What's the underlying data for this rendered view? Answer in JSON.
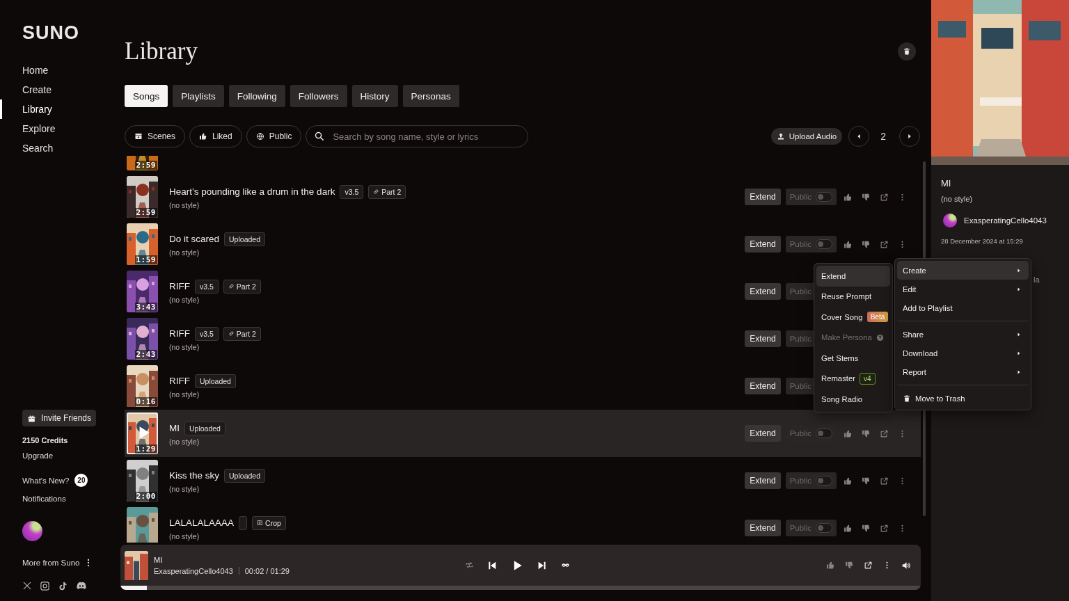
{
  "sidebar": {
    "logo": "SUNO",
    "nav": [
      {
        "label": "Home",
        "selected": false
      },
      {
        "label": "Create",
        "selected": false
      },
      {
        "label": "Library",
        "selected": true
      },
      {
        "label": "Explore",
        "selected": false
      },
      {
        "label": "Search",
        "selected": false
      }
    ],
    "invite_button": "Invite Friends",
    "credits": "2150 Credits",
    "upgrade": "Upgrade",
    "whats_new": {
      "label": "What's New?",
      "count": "20"
    },
    "notifications": "Notifications",
    "more_from": "More from Suno"
  },
  "page": {
    "title": "Library"
  },
  "tabs": [
    {
      "label": "Songs",
      "selected": true
    },
    {
      "label": "Playlists",
      "selected": false
    },
    {
      "label": "Following",
      "selected": false
    },
    {
      "label": "Followers",
      "selected": false
    },
    {
      "label": "History",
      "selected": false
    },
    {
      "label": "Personas",
      "selected": false
    }
  ],
  "filters": [
    {
      "label": "Scenes",
      "kind": "scenes"
    },
    {
      "label": "Liked",
      "kind": "liked"
    },
    {
      "label": "Public",
      "kind": "public"
    }
  ],
  "search": {
    "placeholder": "Search by song name, style or lyrics"
  },
  "upload_button": "Upload Audio",
  "pagination": {
    "page": "2"
  },
  "songs": [
    {
      "duration": "2:59",
      "selected": false
    },
    {
      "title": "Heart’s pounding like a drum in the dark",
      "badges": [
        {
          "kind": "version",
          "text": "v3.5"
        },
        {
          "kind": "part",
          "text": "Part 2"
        }
      ],
      "style": "(no style)",
      "duration": "2:59",
      "selected": false,
      "public": false,
      "extend_label": "Extend",
      "public_label": "Public"
    },
    {
      "title": "Do it scared",
      "badges": [
        {
          "kind": "uploaded",
          "text": "Uploaded"
        }
      ],
      "style": "(no style)",
      "duration": "1:59",
      "selected": false,
      "public": false,
      "extend_label": "Extend",
      "public_label": "Public"
    },
    {
      "title": "RIFF",
      "badges": [
        {
          "kind": "version",
          "text": "v3.5"
        },
        {
          "kind": "part",
          "text": "Part 2"
        }
      ],
      "style": "(no style)",
      "duration": "3:43",
      "selected": false,
      "extend_label": "Extend",
      "public_label": "Public"
    },
    {
      "title": "RIFF",
      "badges": [
        {
          "kind": "version",
          "text": "v3.5"
        },
        {
          "kind": "part",
          "text": "Part 2"
        }
      ],
      "style": "(no style)",
      "duration": "2:43",
      "selected": false,
      "extend_label": "Extend",
      "public_label": "Public"
    },
    {
      "title": "RIFF",
      "badges": [
        {
          "kind": "uploaded",
          "text": "Uploaded"
        }
      ],
      "style": "(no style)",
      "duration": "0:16",
      "selected": false,
      "extend_label": "Extend",
      "public_label": "Public"
    },
    {
      "title": "MI",
      "badges": [
        {
          "kind": "uploaded",
          "text": "Uploaded"
        }
      ],
      "style": "(no style)",
      "duration": "1:29",
      "selected": true,
      "public": false,
      "extend_label": "Extend",
      "public_label": "Public"
    },
    {
      "title": "Kiss the sky",
      "badges": [
        {
          "kind": "uploaded",
          "text": "Uploaded"
        }
      ],
      "style": "(no style)",
      "duration": "2:00",
      "selected": false,
      "public": false,
      "extend_label": "Extend",
      "public_label": "Public"
    },
    {
      "title": "LALALALAAAA",
      "badges": [
        {
          "kind": "blank"
        },
        {
          "kind": "crop",
          "text": "Crop"
        }
      ],
      "style": "(no style)",
      "selected": false,
      "public": false,
      "extend_label": "Extend",
      "public_label": "Public"
    }
  ],
  "context_menu": {
    "actions": [
      {
        "label": "Extend",
        "selected": true,
        "disabled": false
      },
      {
        "label": "Reuse Prompt",
        "selected": false,
        "disabled": false
      },
      {
        "label": "Cover Song",
        "selected": false,
        "disabled": false,
        "badge": {
          "kind": "beta",
          "text": "Beta"
        }
      },
      {
        "label": "Make Persona",
        "selected": false,
        "disabled": true,
        "help": true
      },
      {
        "label": "Get Stems",
        "selected": false,
        "disabled": false
      },
      {
        "label": "Remaster",
        "selected": false,
        "disabled": false,
        "badge": {
          "kind": "new",
          "text": "v4"
        }
      },
      {
        "label": "Song Radio",
        "selected": false,
        "disabled": false
      }
    ],
    "groups": [
      {
        "items": [
          {
            "label": "Create",
            "kind": "item",
            "selected": true,
            "submenu": true
          },
          {
            "label": "Edit",
            "kind": "item",
            "selected": false,
            "submenu": true
          },
          {
            "label": "Add to Playlist",
            "kind": "item",
            "selected": false,
            "submenu": false
          }
        ]
      },
      {
        "items": [
          {
            "label": "Share",
            "kind": "item",
            "selected": false,
            "submenu": true
          },
          {
            "label": "Download",
            "kind": "item",
            "selected": false,
            "submenu": true
          },
          {
            "label": "Report",
            "kind": "item",
            "selected": false,
            "submenu": true
          }
        ]
      },
      {
        "items": [
          {
            "label": "Move to Trash",
            "kind": "trash",
            "selected": false,
            "submenu": false
          }
        ]
      }
    ]
  },
  "details": {
    "title": "MI",
    "style": "(no style)",
    "artist": "ExasperatingCello4043",
    "date": "28 December 2024 at 15:29",
    "text_fragment": "la"
  },
  "player": {
    "title": "MI",
    "artist": "ExasperatingCello4043",
    "time": "00:02 / 01:29",
    "level": 0.033
  }
}
